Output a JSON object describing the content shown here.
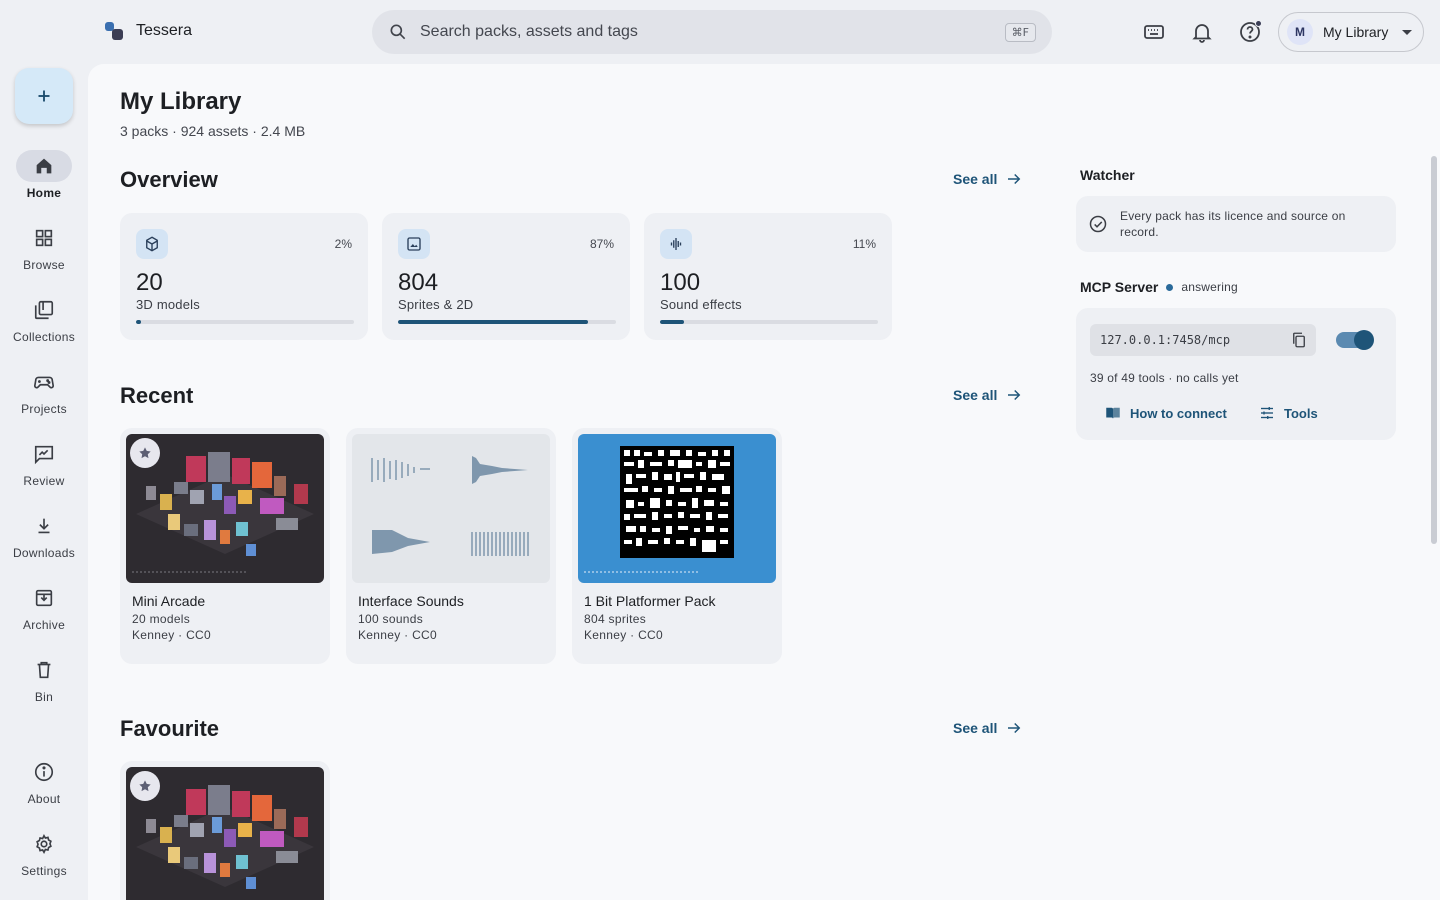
{
  "app": {
    "name": "Tessera"
  },
  "search": {
    "placeholder": "Search packs, assets and tags",
    "shortcut": "⌘F"
  },
  "header_icons": [
    "keyboard-icon",
    "bell-icon",
    "help-icon"
  ],
  "account": {
    "initial": "M",
    "label": "My Library"
  },
  "nav": {
    "items": [
      {
        "label": "Home",
        "icon": "home-icon",
        "active": true
      },
      {
        "label": "Browse",
        "icon": "grid-icon"
      },
      {
        "label": "Collections",
        "icon": "collections-icon"
      },
      {
        "label": "Projects",
        "icon": "gamepad-icon"
      },
      {
        "label": "Review",
        "icon": "review-icon"
      },
      {
        "label": "Downloads",
        "icon": "download-icon"
      },
      {
        "label": "Archive",
        "icon": "archive-icon"
      },
      {
        "label": "Bin",
        "icon": "trash-icon"
      }
    ],
    "bottom": [
      {
        "label": "About",
        "icon": "info-icon"
      },
      {
        "label": "Settings",
        "icon": "gear-icon"
      }
    ]
  },
  "page": {
    "title": "My Library",
    "subtitle": "3 packs · 924 assets · 2.4 MB"
  },
  "overview": {
    "title": "Overview",
    "see_all": "See all",
    "stats": [
      {
        "value": "20",
        "label": "3D models",
        "percent_text": "2%",
        "fraction": 0.022,
        "icon": "cube-icon"
      },
      {
        "value": "804",
        "label": "Sprites & 2D",
        "percent_text": "87%",
        "fraction": 0.87,
        "icon": "image-icon"
      },
      {
        "value": "100",
        "label": "Sound effects",
        "percent_text": "11%",
        "fraction": 0.11,
        "icon": "audio-icon"
      }
    ]
  },
  "recent": {
    "title": "Recent",
    "see_all": "See all",
    "packs": [
      {
        "name": "Mini Arcade",
        "count": "20 models",
        "meta": "Kenney · CC0"
      },
      {
        "name": "Interface Sounds",
        "count": "100 sounds",
        "meta": "Kenney · CC0"
      },
      {
        "name": "1 Bit Platformer Pack",
        "count": "804 sprites",
        "meta": "Kenney · CC0"
      }
    ]
  },
  "favourite": {
    "title": "Favourite",
    "see_all": "See all"
  },
  "watcher": {
    "title": "Watcher",
    "message": "Every pack has its licence and source on record."
  },
  "mcp": {
    "title": "MCP Server",
    "status": "answering",
    "url": "127.0.0.1:7458/mcp",
    "enabled": true,
    "tools_text": "39 of 49 tools · no calls yet",
    "connect_label": "How to connect",
    "tools_label": "Tools"
  },
  "colors": {
    "accent": "#1e5478",
    "surface": "#f8f9fb",
    "background": "#eef0f4"
  }
}
